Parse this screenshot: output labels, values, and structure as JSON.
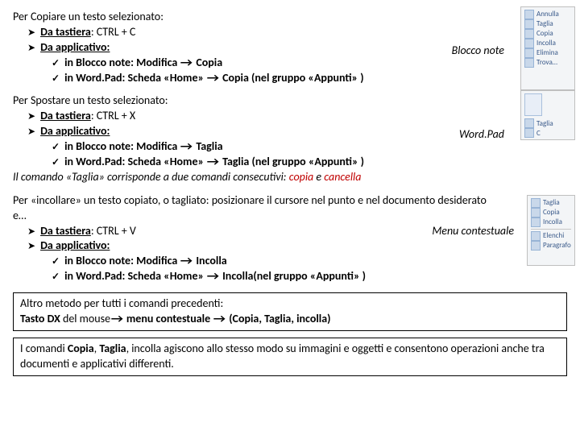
{
  "sec1": {
    "title": "Per Copiare un testo selezionato:",
    "kb_label": "Da tastiera",
    "kb_val": ": CTRL + C",
    "app_label": "Da applicativo:",
    "sub1a": "in Blocco note: Modifica",
    "sub1b": "Copia",
    "sub2a": "in Word.Pad: Scheda «Home»",
    "sub2b": "Copia (nel gruppo «Appunti» )",
    "float": "Blocco note"
  },
  "sec2": {
    "title": "Per Spostare un testo selezionato:",
    "kb_label": "Da tastiera",
    "kb_val": ": CTRL + X",
    "app_label": "Da applicativo:",
    "sub1a": "in Blocco note: Modifica",
    "sub1b": "Taglia",
    "sub2a": "in Word.Pad: Scheda «Home»",
    "sub2b": "Taglia (nel gruppo «Appunti» )",
    "note_a": "Il comando «Taglia» corrisponde a due comandi consecutivi: ",
    "note_b": "copia",
    "note_c": " e ",
    "note_d": "cancella",
    "float": "Word.Pad"
  },
  "sec3": {
    "title": "Per «incollare» un testo copiato, o tagliato: posizionare il cursore nel punto e nel documento desiderato e…",
    "kb_label": "Da tastiera",
    "kb_val": ": CTRL + V",
    "app_label": "Da applicativo:",
    "sub1a": "in Blocco note: Modifica",
    "sub1b": "Incolla",
    "sub2a": "in Word.Pad: Scheda «Home»",
    "sub2b": "Incolla(nel gruppo «Appunti» )",
    "float": "Menu contestuale"
  },
  "box1": {
    "a": "Altro metodo per tutti i comandi precedenti:",
    "b1": "Tasto DX",
    "b2": " del mouse",
    "b3": "menu contestuale",
    "b4": "(Copia, Taglia, incolla)"
  },
  "box2": {
    "a": "I comandi ",
    "b": "Copia",
    "c": ", ",
    "d": "Taglia",
    "e": ", incolla agiscono allo stesso modo su immagini e oggetti e consentono operazioni anche tra documenti e applicativi differenti."
  },
  "thumbs": {
    "notepad": [
      "Annulla",
      "Taglia",
      "Copia",
      "Incolla",
      "Elimina",
      "Trova…"
    ],
    "wordpad": [
      "Taglia",
      "C"
    ],
    "context": [
      "Taglia",
      "Copia",
      "Incolla",
      "Elenchi",
      "Paragrafo"
    ]
  }
}
